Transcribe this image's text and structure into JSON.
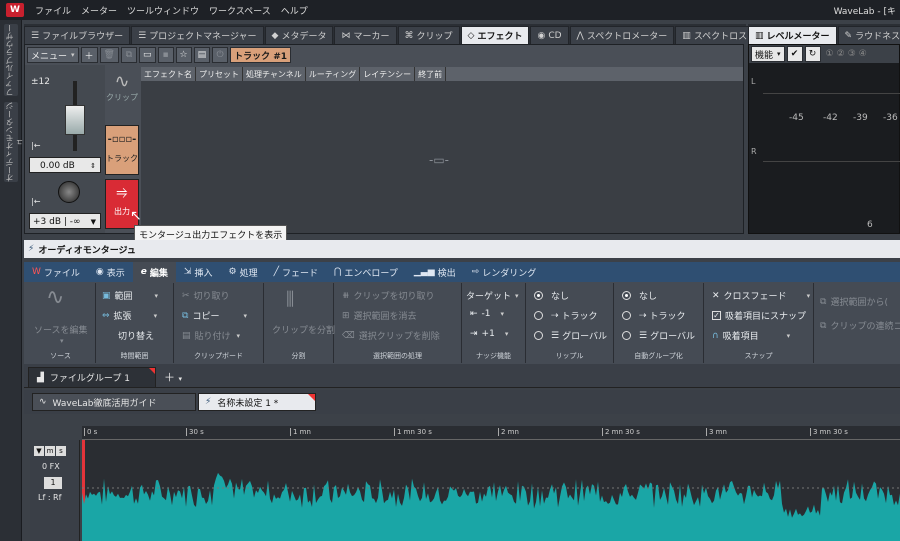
{
  "menu": {
    "items": [
      "ファイル",
      "メーター",
      "ツールウィンドウ",
      "ワークスペース",
      "ヘルプ"
    ],
    "window_title": "WaveLab - [キ"
  },
  "sidebar": {
    "items": [
      "ファイルブラウザー",
      "オーディオモンタージュ"
    ]
  },
  "top_tabs": [
    "ファイルブラウザー",
    "プロジェクトマネージャー",
    "メタデータ",
    "マーカー",
    "クリップ",
    "エフェクト",
    "CD",
    "スペクトロメーター",
    "スペクトロスコープ"
  ],
  "meter_tabs": [
    "レベルメーター",
    "ラウドネスメ"
  ],
  "effects": {
    "menu_label": "メニュー",
    "track_label": "トラック #1",
    "columns": [
      "エフェクト名",
      "プリセット",
      "処理チャンネル",
      "ルーティング",
      "レイテンシー",
      "終了前"
    ],
    "gain_top": "±12",
    "gain_value": "0.00 dB",
    "pan_value": "+3 dB | -∞",
    "clip_button": "クリップ",
    "track_button": "トラック",
    "output_button": "出力",
    "tooltip": "モンタージュ出力エフェクトを表示"
  },
  "meter": {
    "toolbar_label": "機能",
    "channels": [
      "L",
      "R"
    ],
    "scale": [
      "-45",
      "-42",
      "-39",
      "-36"
    ],
    "bottom_value": "6",
    "num_buttons": [
      "①",
      "②",
      "③",
      "④"
    ]
  },
  "montage": {
    "title": "オーディオモンタージュ",
    "ribbon_tabs": [
      "ファイル",
      "表示",
      "編集",
      "挿入",
      "処理",
      "フェード",
      "エンベロープ",
      "検出",
      "レンダリング"
    ],
    "groups": {
      "source": "ソース",
      "time": "時間範囲",
      "clipboard": "クリップボード",
      "split": "分割",
      "selection": "選択範囲の処理",
      "nudge": "ナッジ機能",
      "ripple": "リップル",
      "autogroup": "自動グループ化",
      "snap": "スナップ"
    },
    "items": {
      "source_edit": "ソースを編集",
      "range": "範囲",
      "extend": "拡張",
      "toggle": "切り替え",
      "cut": "切り取り",
      "copy": "コピー",
      "paste": "貼り付け",
      "split_clip": "クリップを分割",
      "cut_clip": "クリップを切り取り",
      "clear_sel": "選択範囲を消去",
      "delete_clips": "選択クリップを削除",
      "target": "ターゲット",
      "minus1": "-1",
      "plus1": "+1",
      "none": "なし",
      "track": "トラック",
      "global": "グローバル",
      "crossfade": "クロスフェード",
      "snap_items": "吸着項目にスナップ",
      "snap_item": "吸着項目",
      "from_sel": "選択範囲から(",
      "clip_cont": "クリップの連続コ"
    },
    "file_group_tab": "ファイルグループ 1",
    "doc_tabs": [
      "WaveLab徹底活用ガイド",
      "名称未設定 1 *"
    ],
    "ruler": [
      "0 s",
      "30 s",
      "1 mn",
      "1 mn 30 s",
      "2 mn",
      "2 mn 30 s",
      "3 mn",
      "3 mn 30 s"
    ],
    "track": {
      "fx": "0 FX",
      "number": "1",
      "routing": "Lf : Rf"
    }
  },
  "colors": {
    "accent": "#2f4f72",
    "waveform": "#1aa6a6",
    "track_btn": "#d9a07a",
    "output_btn": "#d92b35"
  }
}
